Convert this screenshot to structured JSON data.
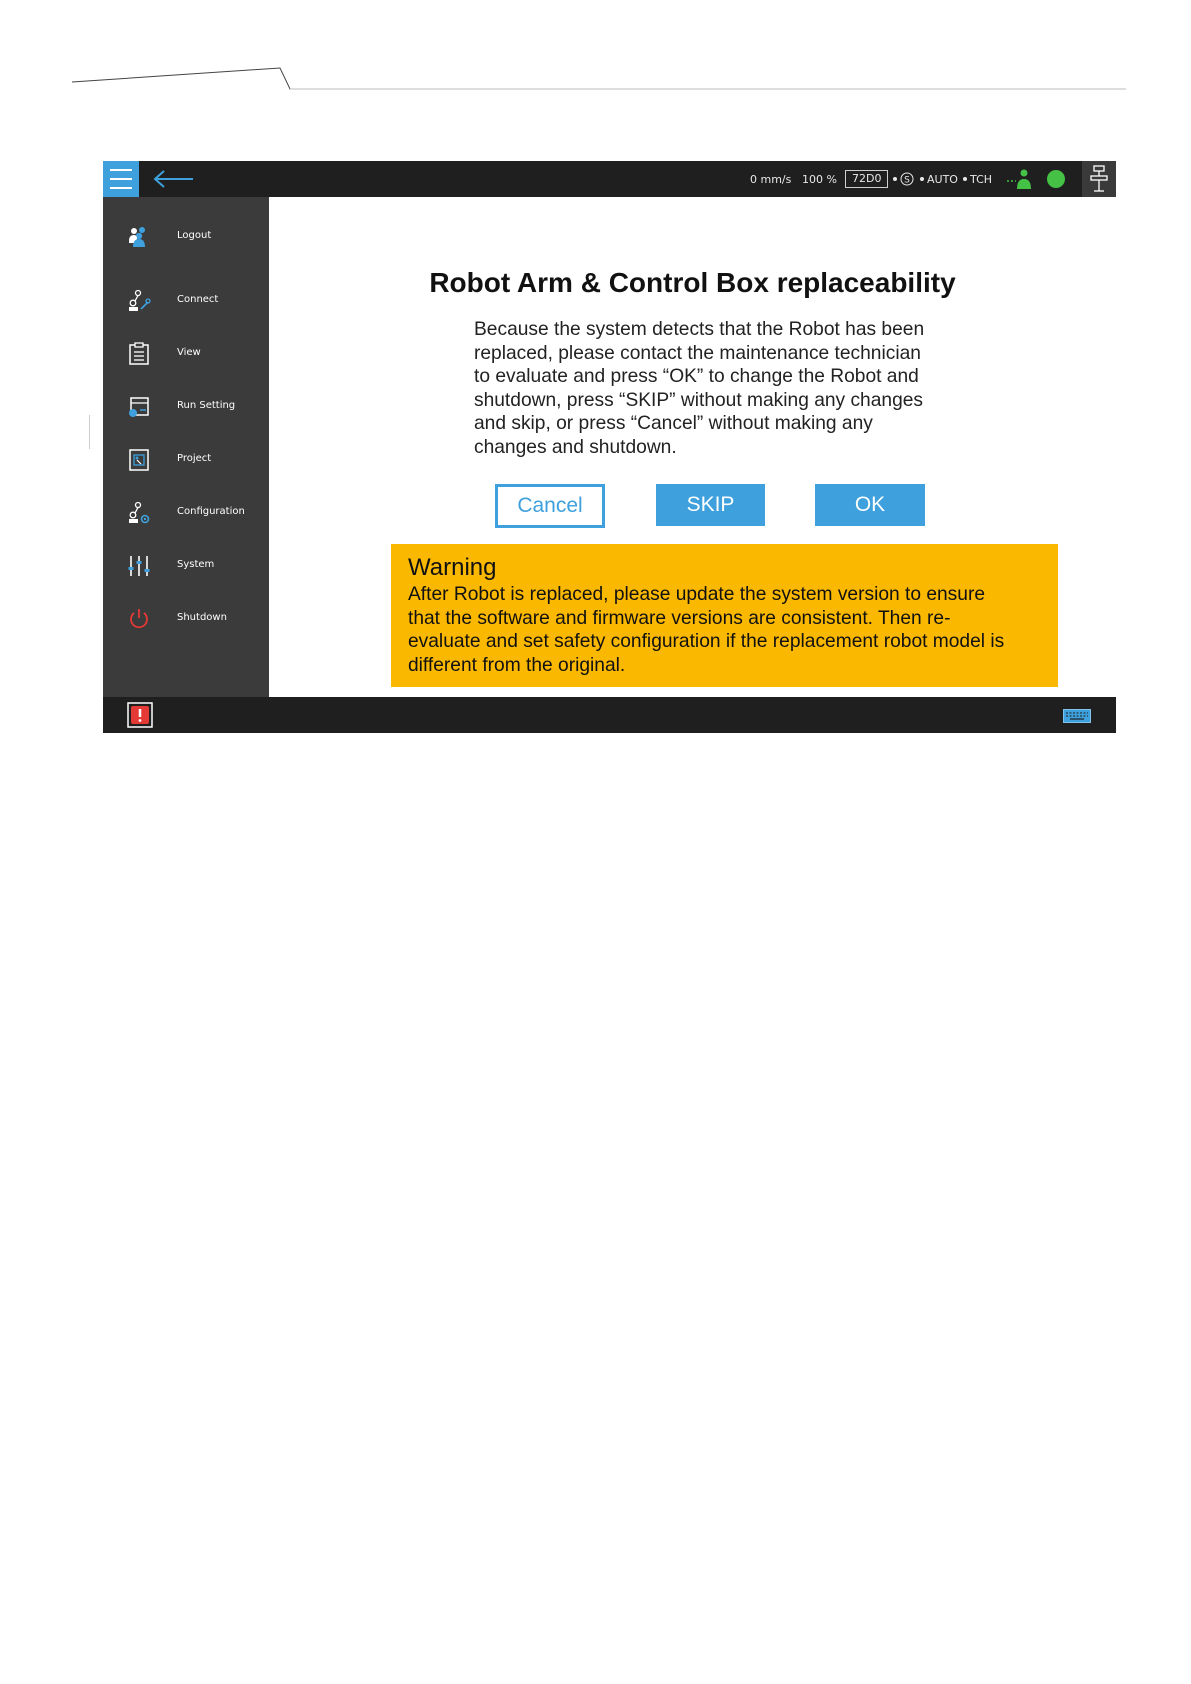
{
  "topbar": {
    "speed": "0 mm/s",
    "percent": "100 %",
    "code": "72D0",
    "safety_symbol": "S",
    "mode": "AUTO",
    "tch": "TCH",
    "accent_color": "#3ea0dc",
    "status_color": "#45c245"
  },
  "sidebar": {
    "items": [
      {
        "label": "Logout",
        "icon": "users-icon"
      },
      {
        "label": "Connect",
        "icon": "connect-icon"
      },
      {
        "label": "View",
        "icon": "clipboard-icon"
      },
      {
        "label": "Run Setting",
        "icon": "run-setting-icon"
      },
      {
        "label": "Project",
        "icon": "project-icon"
      },
      {
        "label": "Configuration",
        "icon": "configuration-icon"
      },
      {
        "label": "System",
        "icon": "sliders-icon"
      },
      {
        "label": "Shutdown",
        "icon": "power-icon"
      }
    ]
  },
  "dialog": {
    "title": "Robot Arm & Control Box replaceability",
    "body_lines": [
      "Because the system detects that the Robot has been",
      "replaced, please contact the maintenance technician",
      "to evaluate and press “OK” to change the Robot and",
      "shutdown, press “SKIP” without making any changes",
      "and skip, or press “Cancel” without making any",
      "changes and shutdown."
    ],
    "cancel_label": "Cancel",
    "skip_label": "SKIP",
    "ok_label": "OK"
  },
  "warning": {
    "title": "Warning",
    "lines": [
      "After Robot is replaced, please update the system version to ensure",
      "that the software and firmware versions are consistent. Then re-",
      "evaluate and set safety configuration if the replacement robot model is",
      "different from the original."
    ],
    "color": "#fbb800"
  }
}
